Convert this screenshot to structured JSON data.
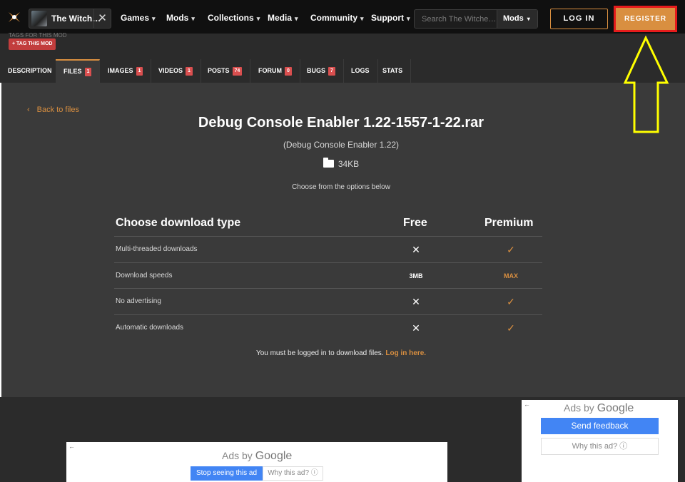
{
  "header": {
    "game_name": "The Witch…",
    "nav": [
      "Games",
      "Mods",
      "Collections",
      "Media",
      "Community",
      "Support"
    ],
    "search_placeholder": "Search The Witche…",
    "search_scope": "Mods",
    "login_label": "LOG IN",
    "register_label": "REGISTER"
  },
  "tagrow": {
    "faint_text": "TAGS FOR THIS MOD",
    "tag_button": "+ TAG THIS MOD"
  },
  "tabs": [
    {
      "label": "DESCRIPTION",
      "badge": ""
    },
    {
      "label": "FILES",
      "badge": "1"
    },
    {
      "label": "IMAGES",
      "badge": "1"
    },
    {
      "label": "VIDEOS",
      "badge": "1"
    },
    {
      "label": "POSTS",
      "badge": "74"
    },
    {
      "label": "FORUM",
      "badge": "0"
    },
    {
      "label": "BUGS",
      "badge": "7"
    },
    {
      "label": "LOGS",
      "badge": ""
    },
    {
      "label": "STATS",
      "badge": ""
    }
  ],
  "main": {
    "back_label": "Back to files",
    "file_title": "Debug Console Enabler 1.22-1557-1-22.rar",
    "file_subtitle": "(Debug Console Enabler 1.22)",
    "file_size": "34KB",
    "choose_text": "Choose from the options below",
    "table": {
      "heading": "Choose download type",
      "col_free": "Free",
      "col_premium": "Premium",
      "rows": [
        {
          "label": "Multi-threaded downloads",
          "free": "✕",
          "premium": "✓"
        },
        {
          "label": "Download speeds",
          "free": "3MB",
          "premium": "MAX"
        },
        {
          "label": "No advertising",
          "free": "✕",
          "premium": "✓"
        },
        {
          "label": "Automatic downloads",
          "free": "✕",
          "premium": "✓"
        }
      ]
    },
    "note_text": "You must be logged in to download files.",
    "note_link": "Log in here."
  },
  "ads": {
    "ads_by": "Ads by",
    "google": "Google",
    "send_feedback": "Send feedback",
    "why_this_ad": "Why this ad? ⓘ",
    "stop_seeing": "Stop seeing this ad"
  },
  "colors": {
    "accent": "#d98f40",
    "highlight_box": "#e61c1c",
    "annotation_arrow": "#ffff00"
  }
}
